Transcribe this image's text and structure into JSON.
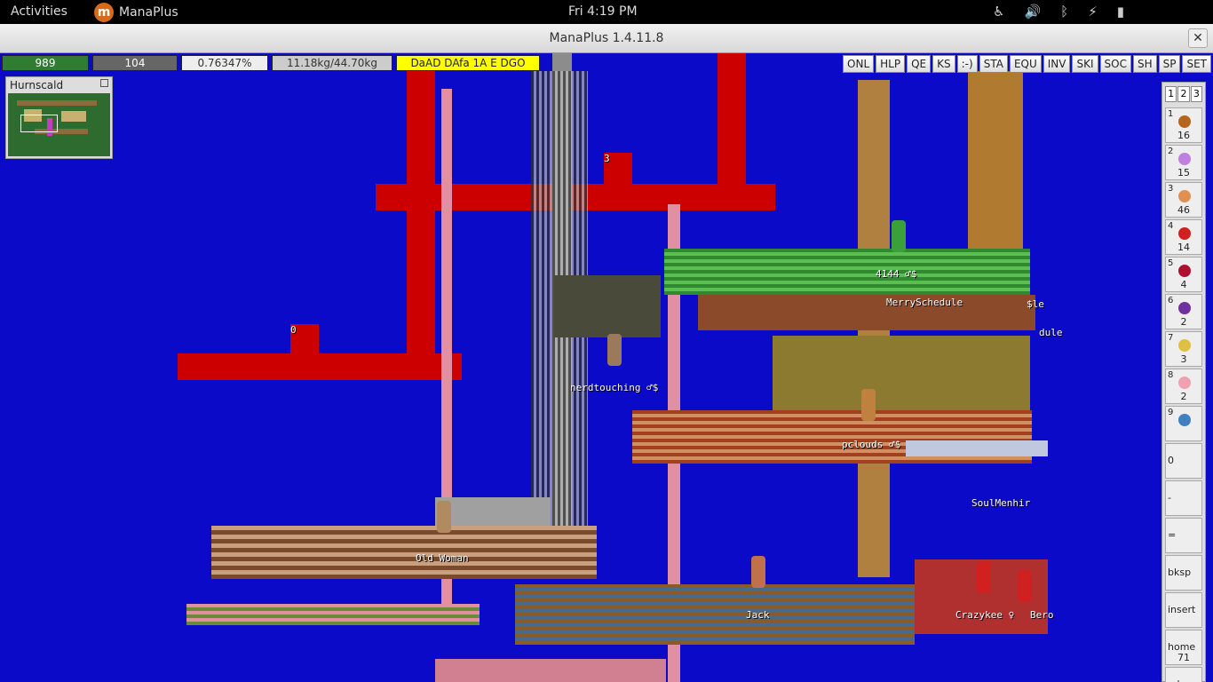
{
  "topbar": {
    "activities": "Activities",
    "app_name": "ManaPlus",
    "clock": "Fri  4:19 PM"
  },
  "window": {
    "title": "ManaPlus 1.4.11.8",
    "close_glyph": "✕"
  },
  "status": {
    "hp": "989",
    "mp": "104",
    "xp": "0.76347%",
    "weight": "11.18kg/44.70kg",
    "status_text": "DaAD DAfa 1A E DGO"
  },
  "menu_buttons": [
    "ONL",
    "HLP",
    "QE",
    "KS",
    ":-)",
    "STA",
    "EQU",
    "INV",
    "SKI",
    "SOC",
    "SH",
    "SP",
    "SET"
  ],
  "minimap": {
    "title": "Hurnscald"
  },
  "shortcuts": {
    "tabs": [
      "1",
      "2",
      "3"
    ],
    "slots": [
      {
        "key": "1",
        "count": "16",
        "color": "#b5651d"
      },
      {
        "key": "2",
        "count": "15",
        "color": "#c080e0"
      },
      {
        "key": "3",
        "count": "46",
        "color": "#e09050"
      },
      {
        "key": "4",
        "count": "14",
        "color": "#d02020"
      },
      {
        "key": "5",
        "count": "4",
        "color": "#b01030"
      },
      {
        "key": "6",
        "count": "2",
        "color": "#7030a0"
      },
      {
        "key": "7",
        "count": "3",
        "color": "#e0c040"
      },
      {
        "key": "8",
        "count": "2",
        "color": "#f0a0b0"
      },
      {
        "key": "9",
        "count": "",
        "color": "#4080c0"
      }
    ],
    "extra": [
      {
        "key": "0",
        "count": ""
      },
      {
        "key": "-",
        "count": ""
      },
      {
        "key": "=",
        "count": ""
      },
      {
        "key": "bksp",
        "count": ""
      },
      {
        "key": "insert",
        "count": ""
      },
      {
        "key": "home",
        "count": "71"
      },
      {
        "key": "u key",
        "count": ""
      }
    ]
  },
  "map_labels": {
    "n3": "3",
    "n0": "0",
    "old_woman": "Old Woman",
    "jack": "Jack",
    "crazykee": "Crazykee ♀",
    "bero": "Bero",
    "pclouds": "pclouds ♂$",
    "soulmenhir": "SoulMenhir",
    "merryschedule": "MerrySchedule",
    "num144": "4144 ♂$",
    "nerdtouching": "nerdtouching ♂$",
    "dule": "dule",
    "le": "$le"
  },
  "colors": {
    "sky": "#0a0ac8",
    "red_wall": "#cc0000",
    "hp_bar": "#2f7d32",
    "status_yellow": "#ffff00"
  }
}
